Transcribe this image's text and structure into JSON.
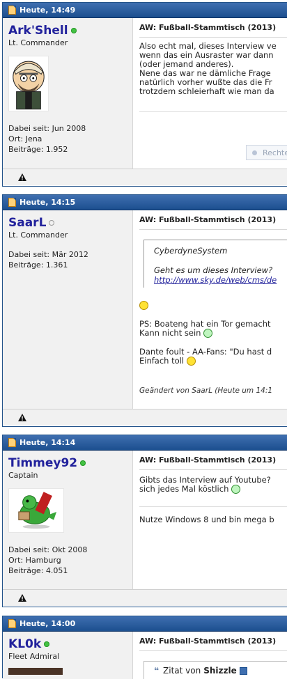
{
  "posts": [
    {
      "time": "Heute, 14:49",
      "username": "Ark'Shell",
      "online": true,
      "usertitle": "Lt. Commander",
      "stats": [
        "Dabei seit: Jun 2008",
        "Ort: Jena",
        "Beiträge: 1.952"
      ],
      "title": "AW: Fußball-Stammtisch (2013)",
      "lines": [
        "Also echt mal, dieses Interview ve",
        "wenn das ein Ausraster war dann",
        "(oder jemand anderes).",
        "Nene das war ne dämliche Frage",
        "natürlich vorher wußte das die Fr",
        "trotzdem schleierhaft wie man da"
      ],
      "button_label": "Rechte"
    },
    {
      "time": "Heute, 14:15",
      "username": "SaarL",
      "online": false,
      "usertitle": "Lt. Commander",
      "stats": [
        "Dabei seit: Mär 2012",
        "Beiträge: 1.361"
      ],
      "title": "AW: Fußball-Stammtisch (2013)",
      "quote_author": "CyberdyneSystem",
      "quote_text": "Geht es um dieses Interview?",
      "quote_link": "http://www.sky.de/web/cms/de",
      "lines": [
        "PS: Boateng hat ein Tor gemacht",
        "Kann nicht sein",
        "Dante foult - AA-Fans: \"Du hast d",
        "Einfach toll"
      ],
      "edited": "Geändert von SaarL (Heute um 14:1"
    },
    {
      "time": "Heute, 14:14",
      "username": "Timmey92",
      "online": true,
      "usertitle": "Captain",
      "stats": [
        "Dabei seit: Okt 2008",
        "Ort: Hamburg",
        "Beiträge: 4.051"
      ],
      "title": "AW: Fußball-Stammtisch (2013)",
      "lines": [
        "Gibts das Interview auf Youtube?",
        "sich jedes Mal köstlich"
      ],
      "signature": "Nutze Windows 8 und bin mega b"
    },
    {
      "time": "Heute, 14:00",
      "username": "KL0k",
      "online": true,
      "usertitle": "Fleet Admiral",
      "title": "AW: Fußball-Stammtisch (2013)",
      "quote_prefix": "Zitat von",
      "quote_author": "Shizzle"
    }
  ],
  "icons": {
    "post_icon": "document-icon",
    "report_icon": "warning-triangle-icon",
    "smiley": "smiley-icon",
    "grin": "grin-icon"
  },
  "colors": {
    "header_blue": "#1c4f8f",
    "username_blue": "#22229c",
    "online_green": "#44c244"
  }
}
